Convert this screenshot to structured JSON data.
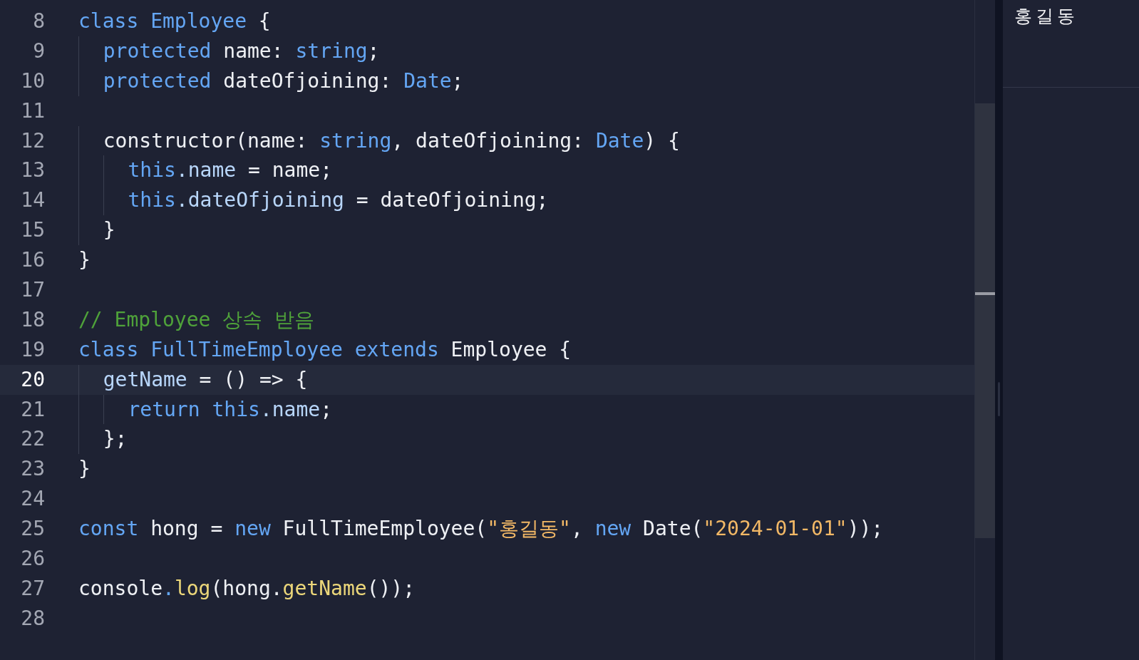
{
  "editor": {
    "lines": [
      {
        "number": "8",
        "current": false,
        "tokens": [
          {
            "kind": "keyword",
            "text": "class "
          },
          {
            "kind": "type",
            "text": "Employee"
          },
          {
            "kind": "plain",
            "text": " {"
          }
        ]
      },
      {
        "number": "9",
        "current": false,
        "tokens": [
          {
            "kind": "keyword",
            "text": "  protected "
          },
          {
            "kind": "plain",
            "text": "name: "
          },
          {
            "kind": "keyword",
            "text": "string"
          },
          {
            "kind": "plain",
            "text": ";"
          }
        ]
      },
      {
        "number": "10",
        "current": false,
        "tokens": [
          {
            "kind": "keyword",
            "text": "  protected "
          },
          {
            "kind": "plain",
            "text": "dateOfjoining: "
          },
          {
            "kind": "keyword",
            "text": "Date"
          },
          {
            "kind": "plain",
            "text": ";"
          }
        ]
      },
      {
        "number": "11",
        "current": false
      },
      {
        "number": "12",
        "current": false,
        "tokens": [
          {
            "kind": "plain",
            "text": "  constructor(name: "
          },
          {
            "kind": "keyword",
            "text": "string"
          },
          {
            "kind": "plain",
            "text": ", dateOfjoining: "
          },
          {
            "kind": "keyword",
            "text": "Date"
          },
          {
            "kind": "plain",
            "text": ") {"
          }
        ]
      },
      {
        "number": "13",
        "current": false,
        "tokens": [
          {
            "kind": "keyword",
            "text": "    this"
          },
          {
            "kind": "property",
            "text": ".name"
          },
          {
            "kind": "plain",
            "text": " = name;"
          }
        ]
      },
      {
        "number": "14",
        "current": false,
        "tokens": [
          {
            "kind": "keyword",
            "text": "    this"
          },
          {
            "kind": "property",
            "text": ".dateOfjoining"
          },
          {
            "kind": "plain",
            "text": " = dateOfjoining;"
          }
        ]
      },
      {
        "number": "15",
        "current": false,
        "tokens": [
          {
            "kind": "plain",
            "text": "  }"
          }
        ]
      },
      {
        "number": "16",
        "current": false,
        "tokens": [
          {
            "kind": "plain",
            "text": "}"
          }
        ]
      },
      {
        "number": "17",
        "current": false
      },
      {
        "number": "18",
        "current": false,
        "tokens": [
          {
            "kind": "comment",
            "text": "// Employee 상속 받음"
          }
        ]
      },
      {
        "number": "19",
        "current": false,
        "tokens": [
          {
            "kind": "keyword",
            "text": "class "
          },
          {
            "kind": "type",
            "text": "FullTimeEmployee "
          },
          {
            "kind": "keyword",
            "text": "extends "
          },
          {
            "kind": "plain",
            "text": "Employee {"
          }
        ]
      },
      {
        "number": "20",
        "current": true,
        "tokens": [
          {
            "kind": "property",
            "text": "  getName"
          },
          {
            "kind": "plain",
            "text": " = () => {"
          }
        ]
      },
      {
        "number": "21",
        "current": false,
        "tokens": [
          {
            "kind": "keyword",
            "text": "    return this"
          },
          {
            "kind": "property",
            "text": ".name"
          },
          {
            "kind": "plain",
            "text": ";"
          }
        ]
      },
      {
        "number": "22",
        "current": false,
        "tokens": [
          {
            "kind": "plain",
            "text": "  };"
          }
        ]
      },
      {
        "number": "23",
        "current": false,
        "tokens": [
          {
            "kind": "plain",
            "text": "}"
          }
        ]
      },
      {
        "number": "24",
        "current": false
      },
      {
        "number": "25",
        "current": false,
        "tokens": [
          {
            "kind": "keyword",
            "text": "const "
          },
          {
            "kind": "plain",
            "text": "hong = "
          },
          {
            "kind": "keyword",
            "text": "new "
          },
          {
            "kind": "plain",
            "text": "FullTimeEmployee("
          },
          {
            "kind": "string",
            "text": "\"홍길동\""
          },
          {
            "kind": "plain",
            "text": ", "
          },
          {
            "kind": "keyword",
            "text": "new "
          },
          {
            "kind": "plain",
            "text": "Date("
          },
          {
            "kind": "string",
            "text": "\"2024-01-01\""
          },
          {
            "kind": "plain",
            "text": "));"
          }
        ]
      },
      {
        "number": "26",
        "current": false
      },
      {
        "number": "27",
        "current": false,
        "tokens": [
          {
            "kind": "plain",
            "text": "console"
          },
          {
            "kind": "keyword",
            "text": "."
          },
          {
            "kind": "function",
            "text": "log"
          },
          {
            "kind": "plain",
            "text": "(hong."
          },
          {
            "kind": "function",
            "text": "getName"
          },
          {
            "kind": "plain",
            "text": "());"
          }
        ]
      },
      {
        "number": "28",
        "current": false
      }
    ]
  },
  "output": {
    "lines": [
      "홍길동"
    ]
  }
}
